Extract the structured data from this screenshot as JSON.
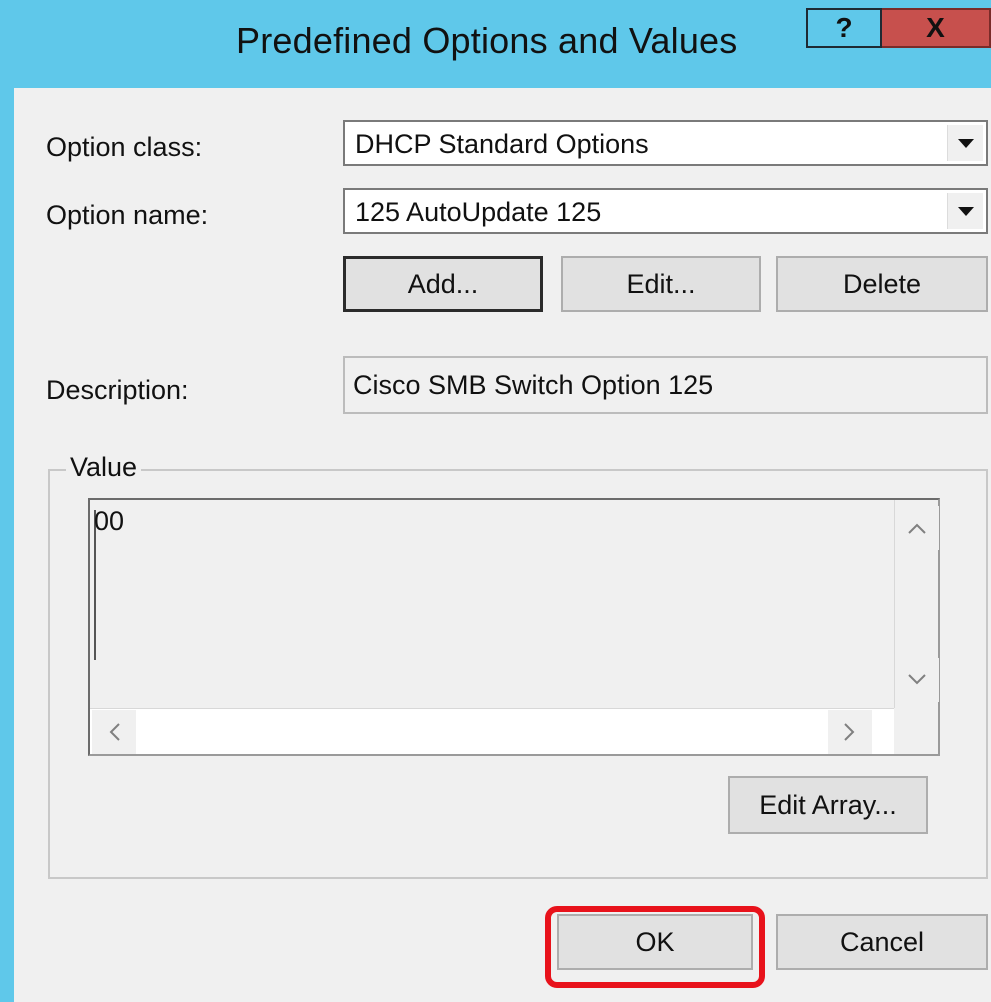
{
  "dialog": {
    "title": "Predefined Options and Values",
    "help_label": "?",
    "close_label": "X"
  },
  "option_class": {
    "label": "Option class:",
    "value": "DHCP Standard Options"
  },
  "option_name": {
    "label": "Option name:",
    "value": "125 AutoUpdate 125"
  },
  "buttons": {
    "add": "Add...",
    "edit": "Edit...",
    "delete": "Delete",
    "edit_array": "Edit Array...",
    "ok": "OK",
    "cancel": "Cancel"
  },
  "description": {
    "label": "Description:",
    "value": "Cisco SMB Switch Option 125"
  },
  "value_group": {
    "title": "Value",
    "text": "00"
  },
  "colors": {
    "titlebar": "#5fc8ea",
    "close_button": "#c7504d",
    "highlight": "#e8121b"
  }
}
